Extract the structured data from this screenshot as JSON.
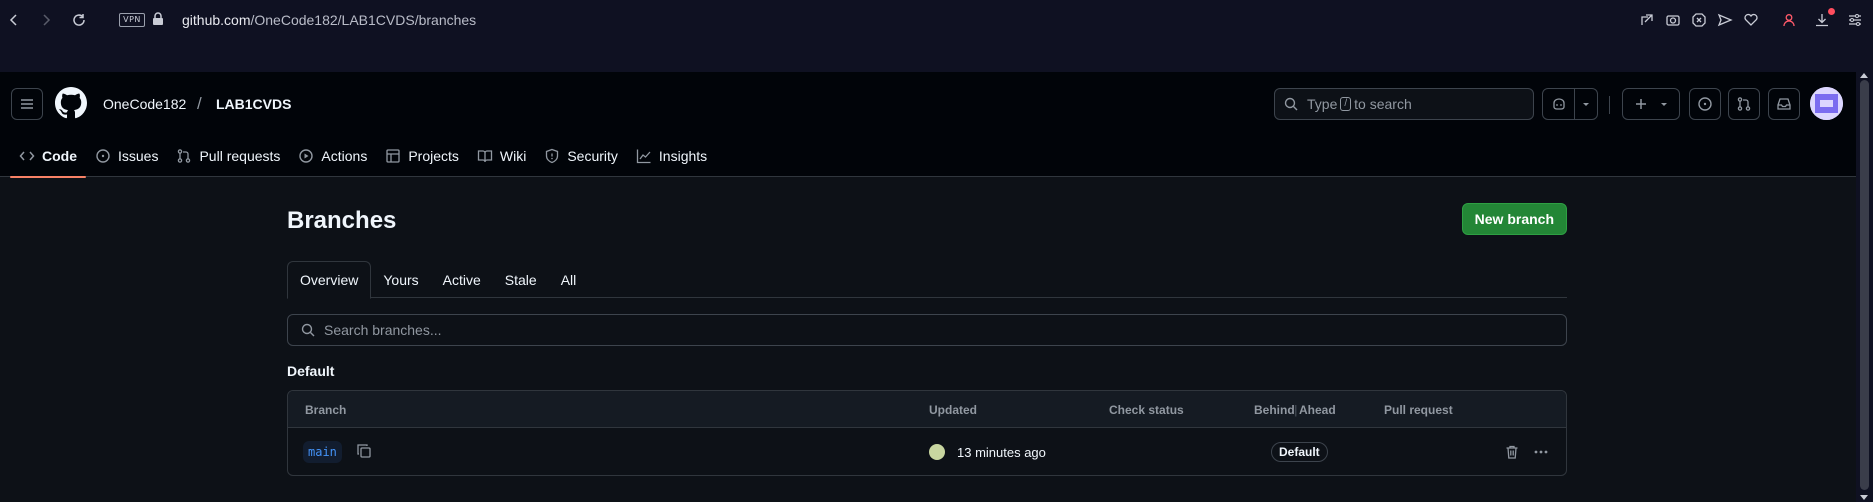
{
  "browser": {
    "url_domain": "github.com",
    "url_path": "/OneCode182/LAB1CVDS/branches",
    "vpn_label": "VPN"
  },
  "header": {
    "owner": "OneCode182",
    "separator": "/",
    "repo": "LAB1CVDS",
    "search_prefix": "Type",
    "search_key": "/",
    "search_suffix": "to search"
  },
  "repo_tabs": [
    {
      "label": "Code",
      "icon": "code-icon",
      "active": true
    },
    {
      "label": "Issues",
      "icon": "issue-opened-icon"
    },
    {
      "label": "Pull requests",
      "icon": "git-pull-request-icon"
    },
    {
      "label": "Actions",
      "icon": "play-icon"
    },
    {
      "label": "Projects",
      "icon": "table-icon"
    },
    {
      "label": "Wiki",
      "icon": "book-icon"
    },
    {
      "label": "Security",
      "icon": "shield-icon"
    },
    {
      "label": "Insights",
      "icon": "graph-icon"
    }
  ],
  "page": {
    "title": "Branches",
    "new_branch_label": "New branch",
    "subnav": [
      "Overview",
      "Yours",
      "Active",
      "Stale",
      "All"
    ],
    "search_placeholder": "Search branches...",
    "section_title": "Default"
  },
  "table": {
    "headers": {
      "branch": "Branch",
      "updated": "Updated",
      "check_status": "Check status",
      "behind": "Behind",
      "ahead": "Ahead",
      "pull_request": "Pull request"
    },
    "rows": [
      {
        "branch": "main",
        "updated": "13 minutes ago",
        "label": "Default"
      }
    ]
  },
  "colors": {
    "accent_green": "#238636",
    "tab_underline": "#f78166",
    "link_blue": "#4493f8"
  }
}
